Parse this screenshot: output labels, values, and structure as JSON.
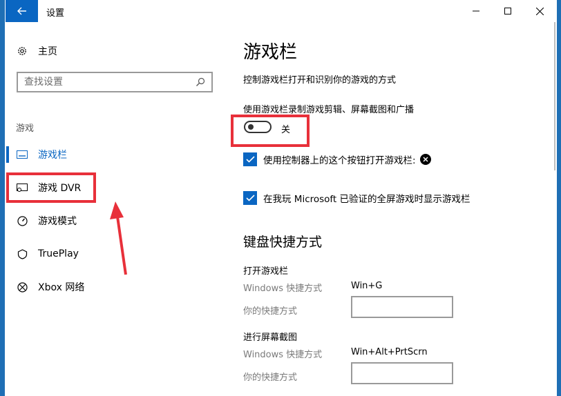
{
  "window": {
    "title": "设置"
  },
  "sidebar": {
    "home_label": "主页",
    "search_placeholder": "查找设置",
    "section_label": "游戏",
    "items": [
      {
        "label": "游戏栏",
        "icon": "gamebar-icon",
        "active": true
      },
      {
        "label": "游戏 DVR",
        "icon": "dvr-icon",
        "active": false
      },
      {
        "label": "游戏模式",
        "icon": "gamemode-icon",
        "active": false
      },
      {
        "label": "TruePlay",
        "icon": "trueplay-icon",
        "active": false
      },
      {
        "label": "Xbox 网络",
        "icon": "xbox-network-icon",
        "active": false
      }
    ]
  },
  "main": {
    "title": "游戏栏",
    "description": "控制游戏栏打开和识别你的游戏的方式",
    "toggle_label": "使用游戏栏录制游戏剪辑、屏幕截图和广播",
    "toggle_state": "关",
    "checkbox_1": "使用控制器上的这个按钮打开游戏栏:",
    "checkbox_2": "在我玩 Microsoft 已验证的全屏游戏时显示游戏栏",
    "keyboard_title": "键盘快捷方式",
    "shortcuts": [
      {
        "heading": "打开游戏栏",
        "windows_label": "Windows 快捷方式",
        "windows_value": "Win+G",
        "custom_label": "你的快捷方式",
        "custom_value": ""
      },
      {
        "heading": "进行屏幕截图",
        "windows_label": "Windows 快捷方式",
        "windows_value": "Win+Alt+PrtScrn",
        "custom_label": "你的快捷方式",
        "custom_value": ""
      }
    ]
  },
  "colors": {
    "accent": "#0a66c2",
    "annotation": "#e8303a",
    "desktop": "#1f6fb5"
  }
}
